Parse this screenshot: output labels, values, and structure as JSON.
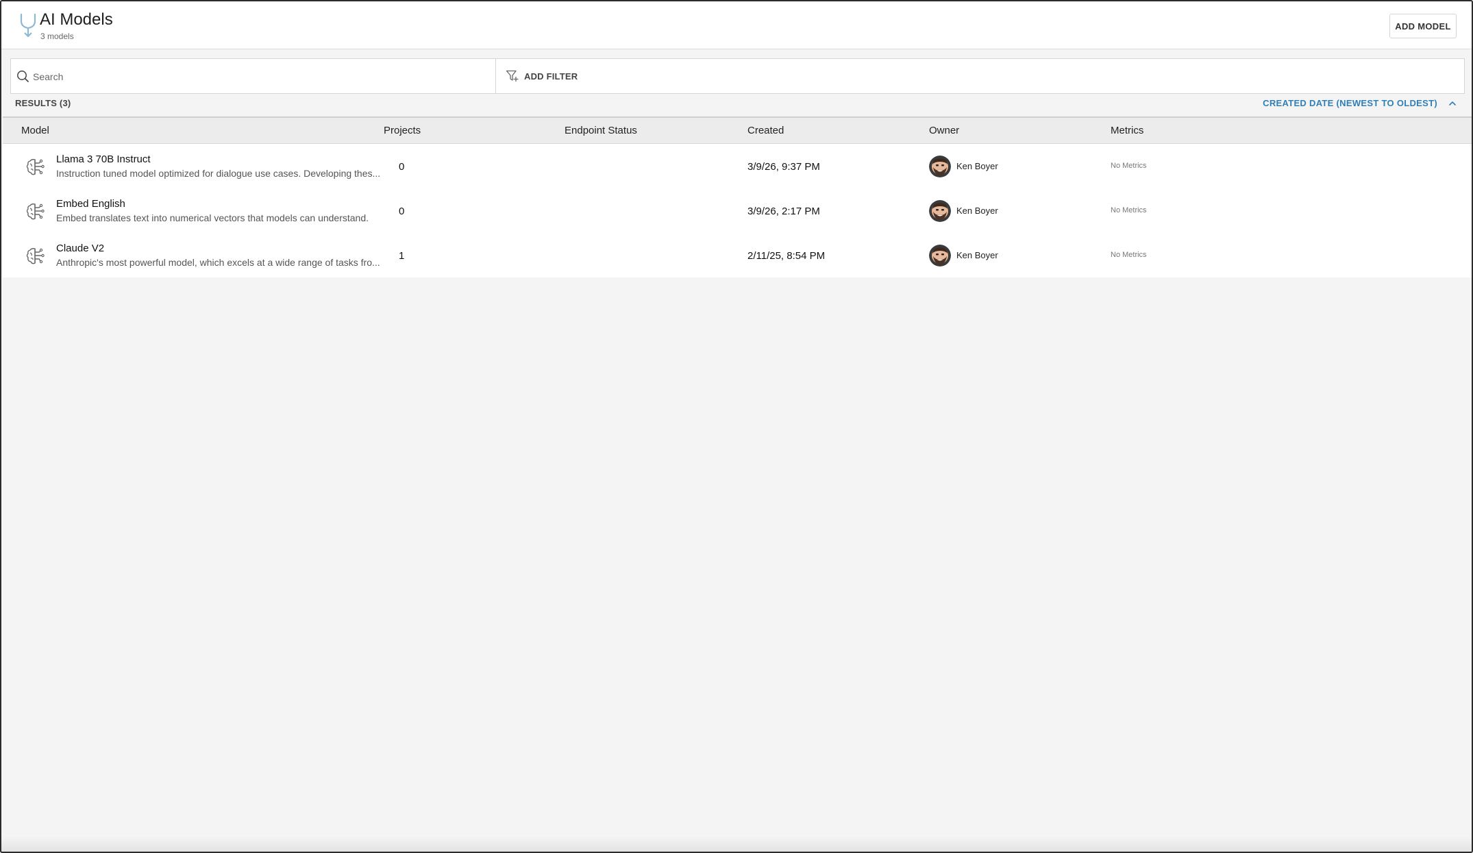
{
  "header": {
    "title": "AI Models",
    "subtitle": "3 models",
    "add_button": "ADD MODEL"
  },
  "search": {
    "placeholder": "Search",
    "value": "",
    "filter_label": "ADD FILTER"
  },
  "results": {
    "label": "RESULTS (3)",
    "sort_label": "CREATED DATE (NEWEST TO OLDEST)"
  },
  "table": {
    "columns": [
      "Model",
      "Projects",
      "Endpoint Status",
      "Created",
      "Owner",
      "Metrics"
    ],
    "rows": [
      {
        "name": "Llama 3 70B Instruct",
        "description": "Instruction tuned model optimized for dialogue use cases. Developing thes...",
        "projects": "0",
        "endpoint_status": "",
        "created": "3/9/26, 9:37 PM",
        "owner": "Ken Boyer",
        "metrics": "No Metrics"
      },
      {
        "name": "Embed English",
        "description": "Embed translates text into numerical vectors that models can understand.",
        "projects": "0",
        "endpoint_status": "",
        "created": "3/9/26, 2:17 PM",
        "owner": "Ken Boyer",
        "metrics": "No Metrics"
      },
      {
        "name": "Claude V2",
        "description": "Anthropic's most powerful model, which excels at a wide range of tasks fro...",
        "projects": "1",
        "endpoint_status": "",
        "created": "2/11/25, 8:54 PM",
        "owner": "Ken Boyer",
        "metrics": "No Metrics"
      }
    ]
  },
  "icons": {
    "app_logo": "model-logo-icon",
    "search": "search-icon",
    "filter": "filter-add-icon",
    "sort": "chevron-up-icon",
    "model": "brain-circuit-icon",
    "avatar": "user-avatar"
  },
  "colors": {
    "accent": "#2f7fb8",
    "background": "#f4f4f4",
    "header_row": "#ececec"
  }
}
